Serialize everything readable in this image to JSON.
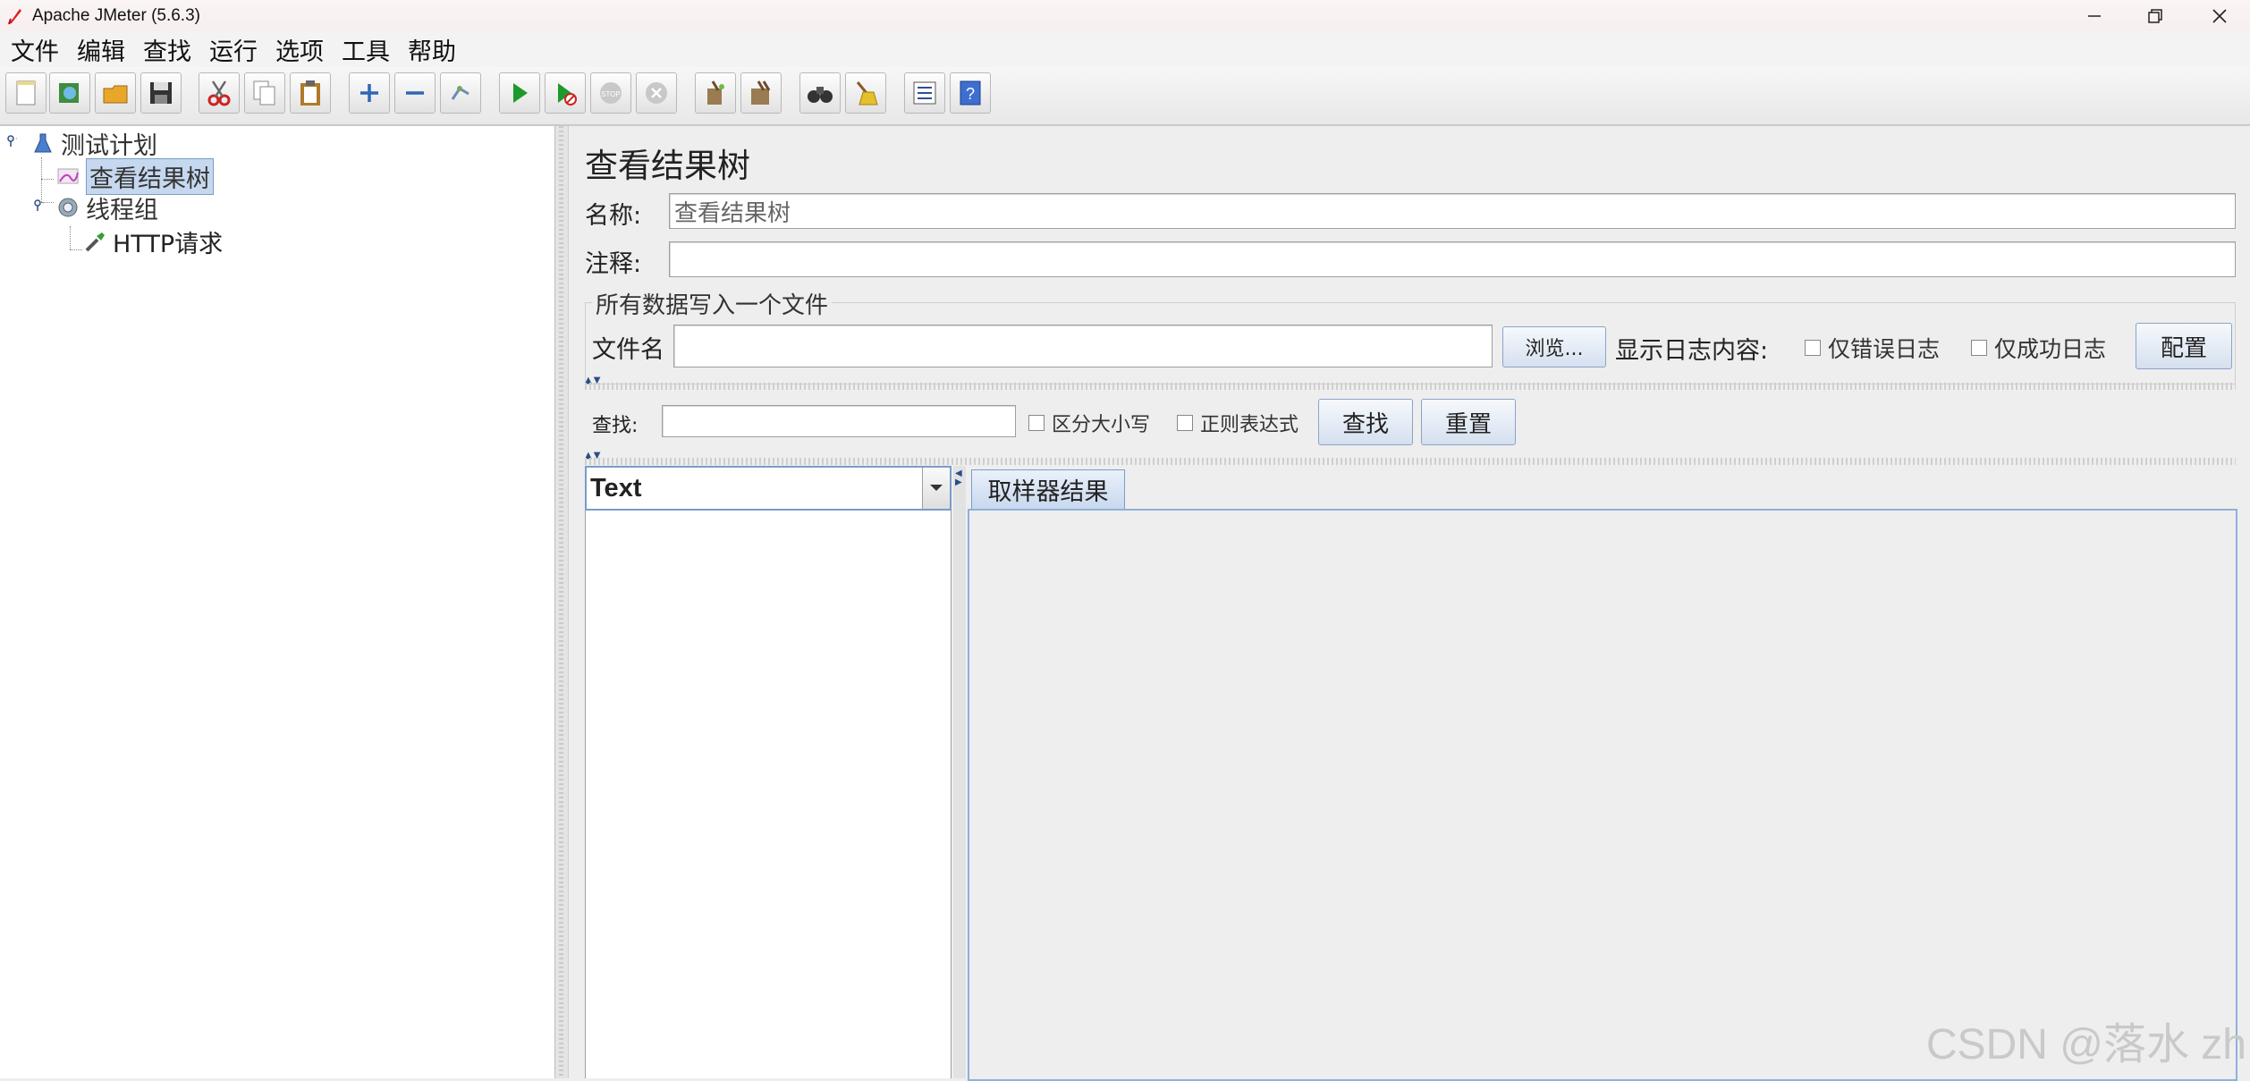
{
  "window": {
    "title": "Apache JMeter (5.6.3)"
  },
  "menu": [
    "文件",
    "编辑",
    "查找",
    "运行",
    "选项",
    "工具",
    "帮助"
  ],
  "toolbar_icons": [
    "new-icon",
    "templates-icon",
    "open-icon",
    "save-icon",
    "cut-icon",
    "copy-icon",
    "paste-icon",
    "expand-icon",
    "collapse-icon",
    "toggle-icon",
    "start-icon",
    "start-no-pause-icon",
    "stop-icon",
    "shutdown-icon",
    "clear-icon",
    "clear-all-icon",
    "search-icon",
    "reset-search-icon",
    "function-helper-icon",
    "help-icon"
  ],
  "tree": {
    "nodes": [
      {
        "label": "测试计划",
        "icon": "flask-icon"
      },
      {
        "label": "查看结果树",
        "icon": "chart-icon",
        "selected": true
      },
      {
        "label": "线程组",
        "icon": "gear-icon"
      },
      {
        "label": "HTTP请求",
        "icon": "pipette-icon"
      }
    ]
  },
  "panel": {
    "title": "查看结果树",
    "name_label": "名称:",
    "name_value": "查看结果树",
    "comment_label": "注释:",
    "comment_value": "",
    "file_group_title": "所有数据写入一个文件",
    "filename_label": "文件名",
    "filename_value": "",
    "browse_button": "浏览...",
    "log_label": "显示日志内容:",
    "errors_only": "仅错误日志",
    "success_only": "仅成功日志",
    "configure_button": "配置"
  },
  "search": {
    "label": "查找:",
    "value": "",
    "case_sensitive": "区分大小写",
    "regex": "正则表达式",
    "find_button": "查找",
    "reset_button": "重置"
  },
  "renderer": {
    "selected": "Text"
  },
  "tabs": [
    "取样器结果"
  ],
  "watermark": "CSDN @落水 zh"
}
